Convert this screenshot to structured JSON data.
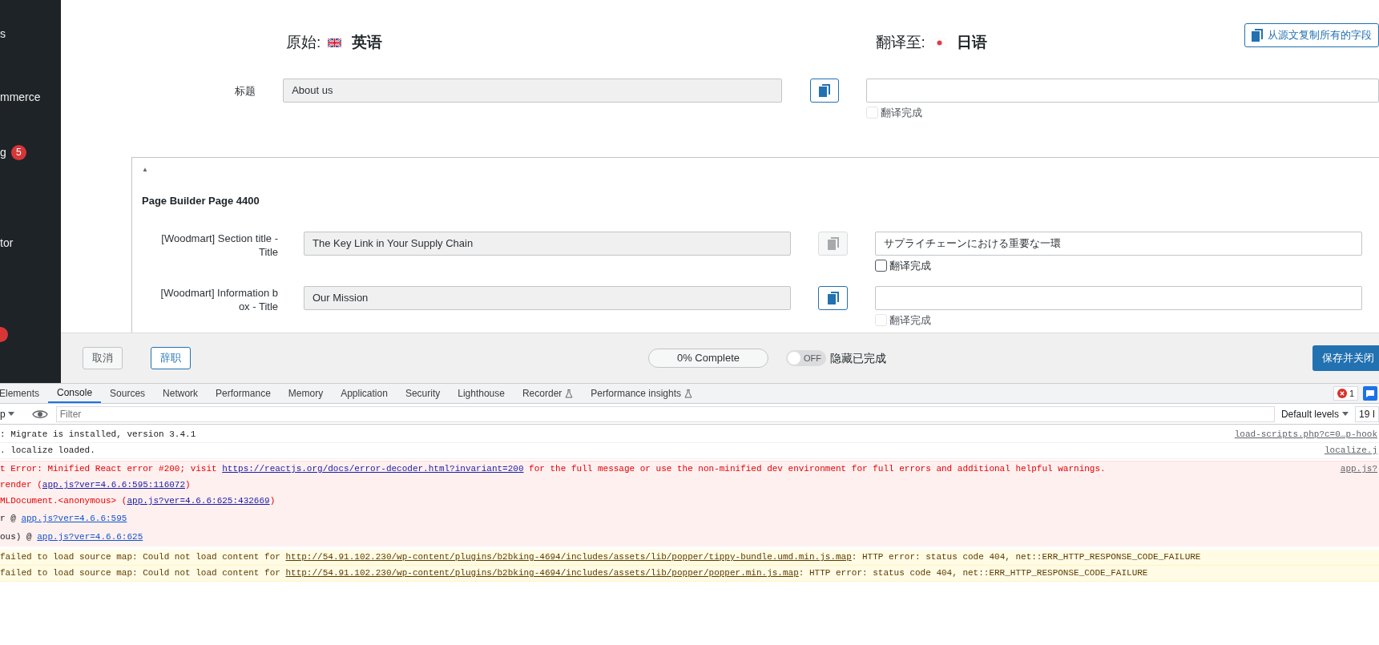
{
  "sidebar": {
    "items": [
      {
        "label": "s"
      },
      {
        "label": "mmerce"
      },
      {
        "label": "g",
        "badge": "5"
      },
      {
        "label": "tor"
      }
    ],
    "cut_badge": true
  },
  "header": {
    "source_label": "原始:",
    "source_language": "英语",
    "target_label": "翻译至:",
    "target_language": "日语",
    "copy_all_button": "从源文复制所有的字段"
  },
  "title_field": {
    "label": "标题",
    "source_value": "About us",
    "copy_disabled": false,
    "complete_label": "翻译完成",
    "complete_checked": false,
    "complete_disabled": true
  },
  "section": {
    "toggle": "▲",
    "title": "Page Builder Page 4400",
    "fields": [
      {
        "label": "[Woodmart] Section title - Title",
        "source_value": "The Key Link in Your Supply Chain",
        "copy_disabled": true,
        "target_value": "サプライチェーンにおける重要な一環",
        "complete_label": "翻译完成",
        "complete_checked": false,
        "complete_disabled": false
      },
      {
        "label": "[Woodmart] Information b ox - Title",
        "source_value": "Our Mission",
        "copy_disabled": false,
        "complete_label": "翻译完成",
        "complete_checked": false,
        "complete_disabled": true
      }
    ]
  },
  "footer": {
    "cancel_button": "取消",
    "resign_button": "辞职",
    "progress": "0% Complete",
    "level": 0,
    "toggle_label": "OFF",
    "toggle_on": false,
    "toggle_text": "隐藏已完成",
    "save_button": "保存并关闭"
  },
  "devtools": {
    "tabs": [
      {
        "label": "Elements",
        "selected": false
      },
      {
        "label": "Console",
        "selected": true
      },
      {
        "label": "Sources",
        "selected": false
      },
      {
        "label": "Network",
        "selected": false
      },
      {
        "label": "Performance",
        "selected": false
      },
      {
        "label": "Memory",
        "selected": false
      },
      {
        "label": "Application",
        "selected": false
      },
      {
        "label": "Security",
        "selected": false
      },
      {
        "label": "Lighthouse",
        "selected": false
      },
      {
        "label": "Recorder",
        "selected": false,
        "kind": "experimental"
      },
      {
        "label": "Performance insights",
        "selected": false,
        "kind": "experimental"
      }
    ],
    "error_count": "1",
    "context": "p",
    "filter_placeholder": "Filter",
    "levels": "Default levels",
    "issues": "19 I",
    "messages": [
      {
        "kind": "log",
        "prefix": ": Migrate is installed, version 3.4.1",
        "source": "load-scripts.php?c=0…p-hook"
      },
      {
        "kind": "log",
        "prefix": ". localize loaded.",
        "source": "localize.j"
      },
      {
        "kind": "error",
        "prefix": "t Error: Minified React error #200; visit ",
        "link": "https://reactjs.org/docs/error-decoder.html?invariant=200",
        "suffix": " for the full message or use the non-minified dev environment for full errors and additional helpful warnings.",
        "source": "app.js?"
      },
      {
        "kind": "error-trace",
        "prefix": "render (",
        "link": "app.js?ver=4.6.6:595:116072",
        "suffix": ")"
      },
      {
        "kind": "error-trace",
        "prefix": "MLDocument.<anonymous> (",
        "link": "app.js?ver=4.6.6:625:432669",
        "suffix": ")"
      },
      {
        "kind": "error-stack",
        "prefix": "r    @ ",
        "link": "app.js?ver=4.6.6:595"
      },
      {
        "kind": "error-stack",
        "prefix": "ous) @ ",
        "link": "app.js?ver=4.6.6:625"
      },
      {
        "kind": "warning",
        "prefix": "failed to load source map: Could not load content for ",
        "link": "http://54.91.102.230/wp-content/plugins/b2bking-4694/includes/assets/lib/popper/tippy-bundle.umd.min.js.map",
        "suffix": ": HTTP error: status code 404, net::ERR_HTTP_RESPONSE_CODE_FAILURE"
      },
      {
        "kind": "warning",
        "prefix": "failed to load source map: Could not load content for ",
        "link": "http://54.91.102.230/wp-content/plugins/b2bking-4694/includes/assets/lib/popper/popper.min.js.map",
        "suffix": ": HTTP error: status code 404, net::ERR_HTTP_RESPONSE_CODE_FAILURE"
      }
    ]
  }
}
